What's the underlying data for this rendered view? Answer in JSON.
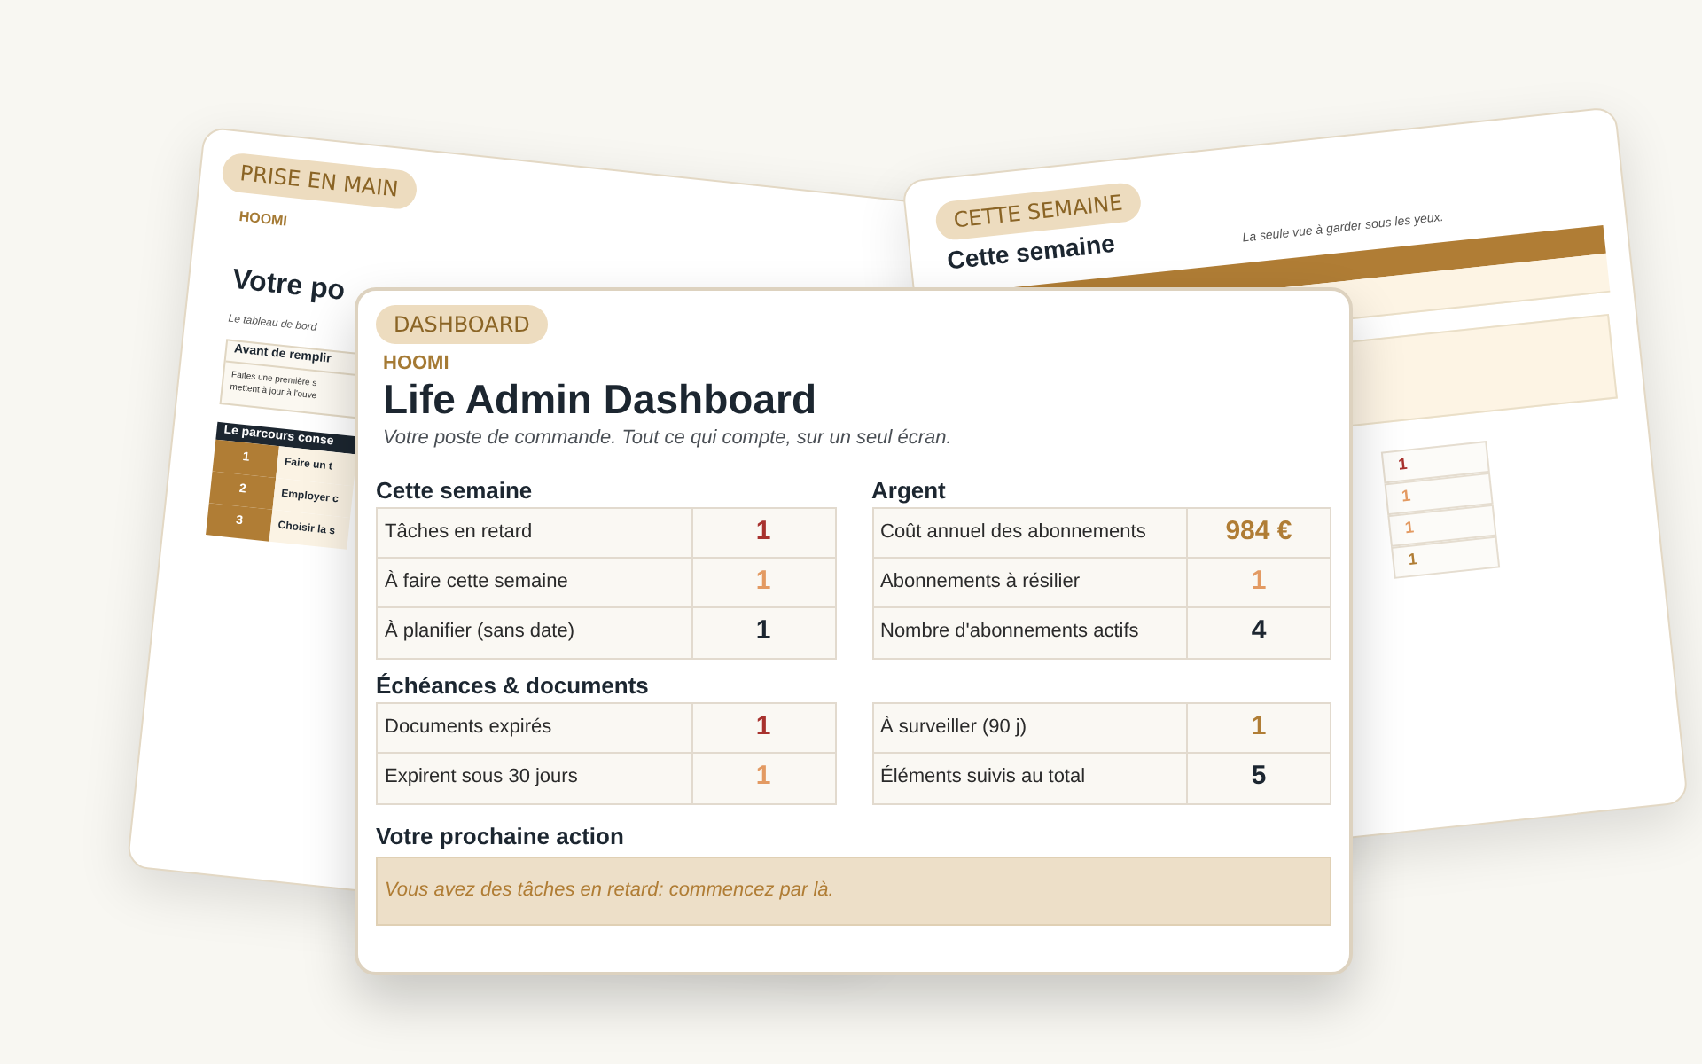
{
  "back_left": {
    "tag": "PRISE EN MAIN",
    "brand": "HOOMI",
    "title": "Votre po",
    "subtitle": "Le tableau de bord",
    "notice": {
      "title": "Avant de remplir",
      "lines": [
        "Faites une première s",
        "mettent à jour à l'ouve"
      ]
    },
    "steps": {
      "title": "Le parcours conse",
      "rows": [
        {
          "number": "1",
          "label": "Faire un t"
        },
        {
          "number": "2",
          "label": "Employer c"
        },
        {
          "number": "3",
          "label": "Choisir la s"
        }
      ]
    }
  },
  "back_right": {
    "tag": "CETTE SEMAINE",
    "title": "Cette semaine",
    "subtitle": "La seule vue à garder sous les yeux.",
    "values": [
      {
        "value": "1",
        "color": "#a8322e"
      },
      {
        "value": "1",
        "color": "#e39a62"
      },
      {
        "value": "1",
        "color": "#e39a62"
      },
      {
        "value": "1",
        "color": "#b07d35"
      }
    ]
  },
  "dashboard": {
    "tag": "DASHBOARD",
    "brand": "HOOMI",
    "title": "Life Admin Dashboard",
    "subtitle": "Votre poste de commande. Tout ce qui compte, sur un seul écran.",
    "sections": [
      {
        "title": "Cette semaine",
        "rows": [
          {
            "label": "Tâches en retard",
            "value": "1",
            "color": "#a8322e"
          },
          {
            "label": "À faire cette semaine",
            "value": "1",
            "color": "#e39a62"
          },
          {
            "label": "À planifier (sans date)",
            "value": "1",
            "color": "#1c2630"
          }
        ]
      },
      {
        "title": "Argent",
        "rows": [
          {
            "label": "Coût annuel des abonnements",
            "value": "984 €",
            "color": "#b07d35"
          },
          {
            "label": "Abonnements à résilier",
            "value": "1",
            "color": "#e39a62"
          },
          {
            "label": "Nombre d'abonnements actifs",
            "value": "4",
            "color": "#1c2630"
          }
        ]
      },
      {
        "title": "Échéances & documents",
        "rows": [
          {
            "label": "Documents expirés",
            "value": "1",
            "color": "#a8322e"
          },
          {
            "label": "Expirent sous 30 jours",
            "value": "1",
            "color": "#e39a62"
          }
        ]
      },
      {
        "rows": [
          {
            "label": "À surveiller (90 j)",
            "value": "1",
            "color": "#b07d35"
          },
          {
            "label": "Éléments suivis au total",
            "value": "5",
            "color": "#1c2630"
          }
        ]
      }
    ],
    "next_action": {
      "title": "Votre prochaine action",
      "message": "Vous avez des tâches en retard: commencez par là."
    }
  }
}
